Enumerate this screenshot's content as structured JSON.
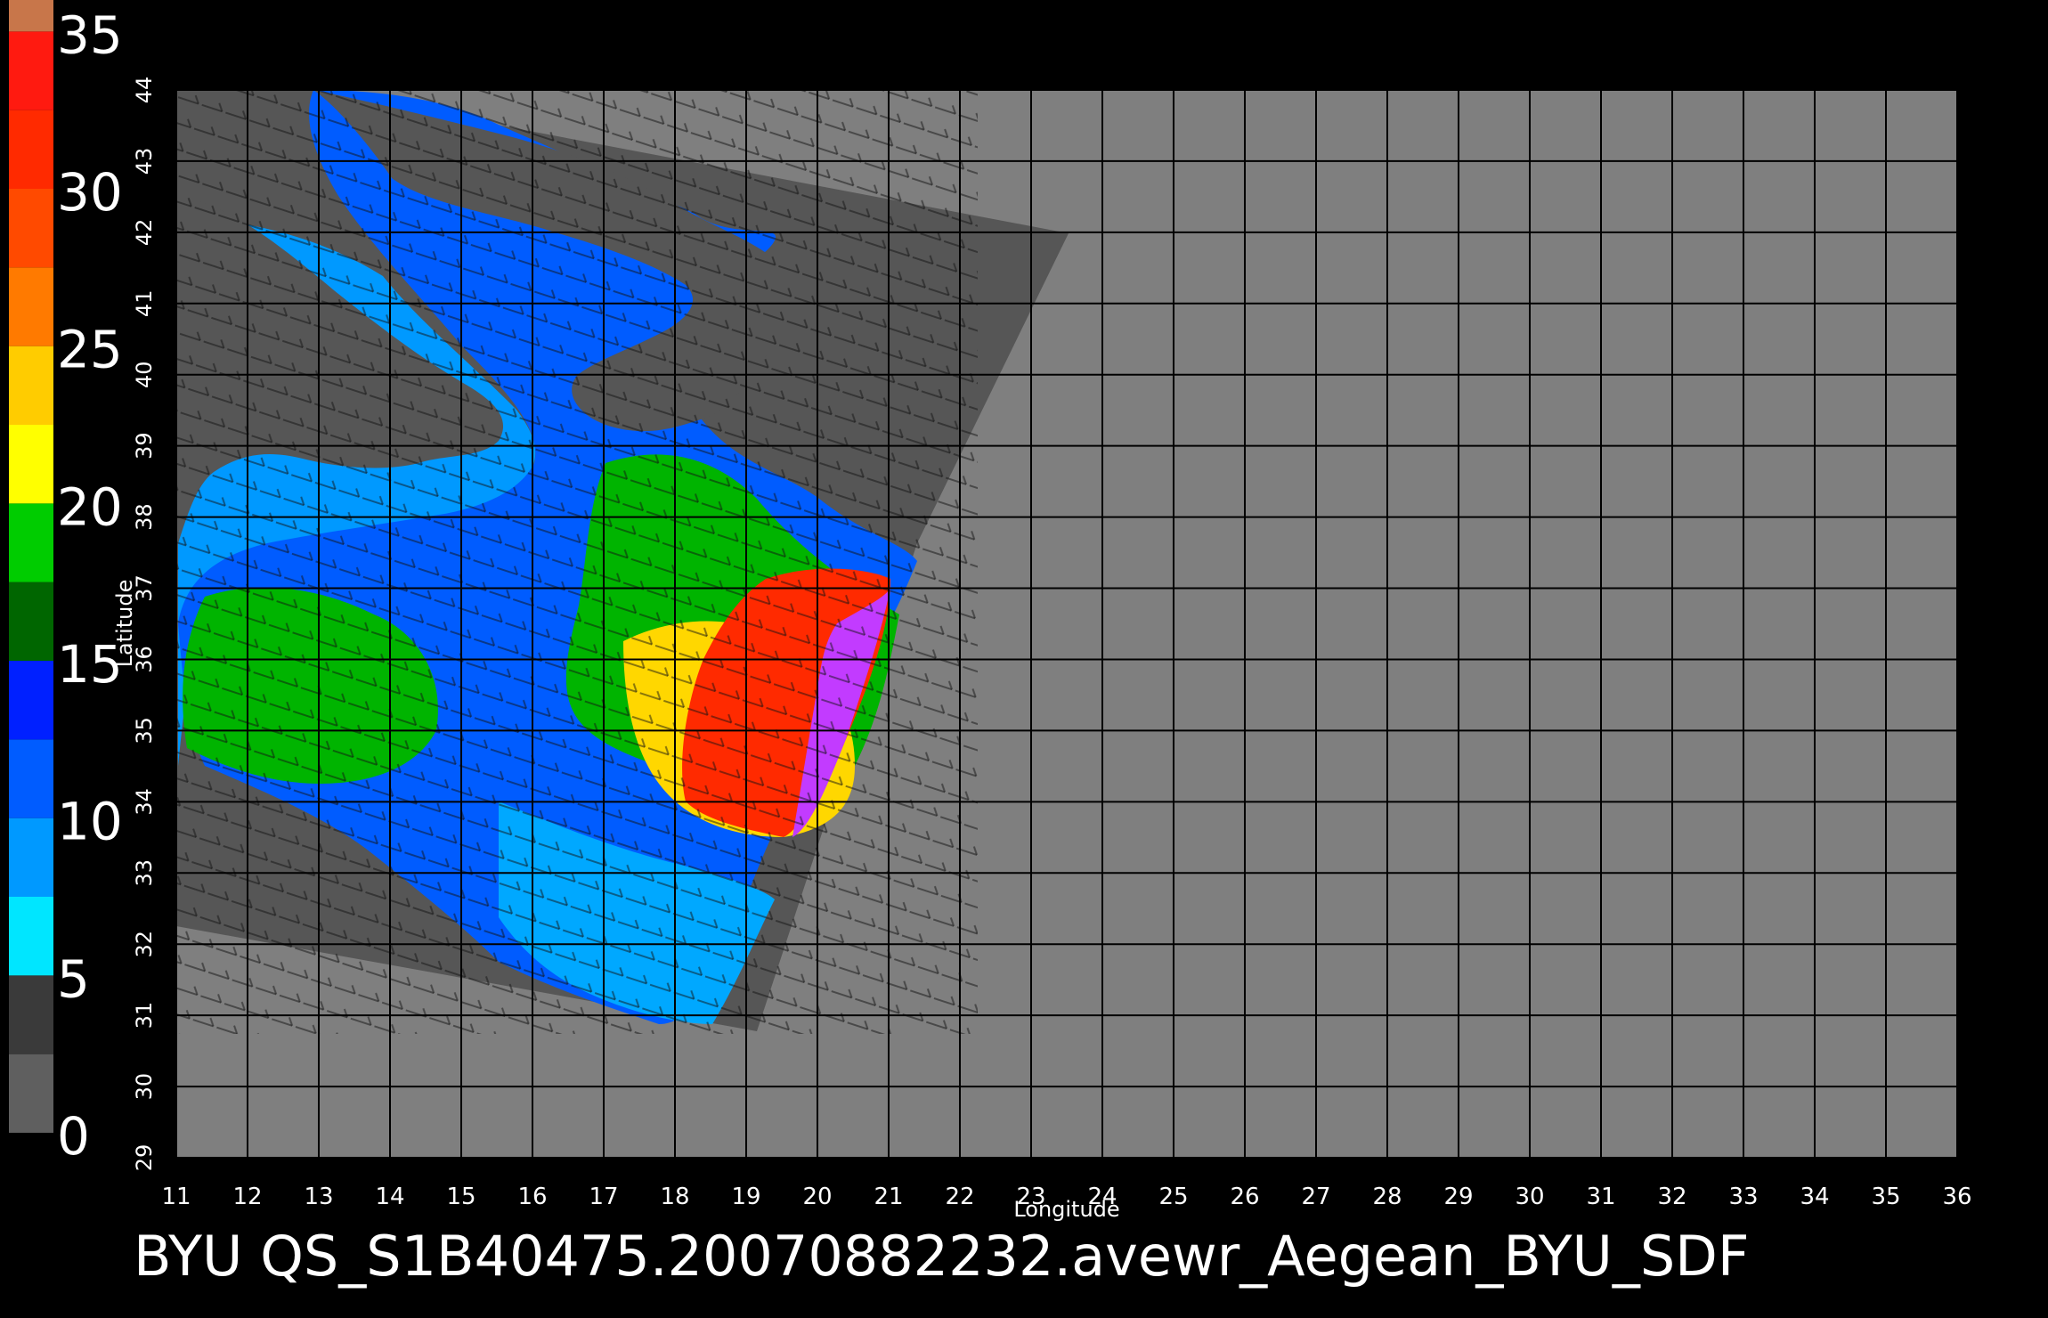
{
  "colorbar": {
    "labels": [
      "35",
      "30",
      "25",
      "20",
      "15",
      "10",
      "5",
      "0"
    ],
    "segments": [
      {
        "from": 0,
        "to": 2.5,
        "color": "#5f5f5f"
      },
      {
        "from": 2.5,
        "to": 5,
        "color": "#3a3a3a"
      },
      {
        "from": 5,
        "to": 7.5,
        "color": "#00e6ff"
      },
      {
        "from": 7.5,
        "to": 10,
        "color": "#0099ff"
      },
      {
        "from": 10,
        "to": 12.5,
        "color": "#005cff"
      },
      {
        "from": 12.5,
        "to": 15,
        "color": "#0020ff"
      },
      {
        "from": 15,
        "to": 17.5,
        "color": "#006600"
      },
      {
        "from": 17.5,
        "to": 20,
        "color": "#00cc00"
      },
      {
        "from": 20,
        "to": 22.5,
        "color": "#ffff00"
      },
      {
        "from": 22.5,
        "to": 25,
        "color": "#ffcc00"
      },
      {
        "from": 25,
        "to": 27.5,
        "color": "#ff7a00"
      },
      {
        "from": 27.5,
        "to": 30,
        "color": "#ff4a00"
      },
      {
        "from": 30,
        "to": 32.5,
        "color": "#ff2a00"
      },
      {
        "from": 32.5,
        "to": 35,
        "color": "#ff1a10"
      },
      {
        "from": 35,
        "to": 36,
        "color": "#c8764a"
      }
    ]
  },
  "map": {
    "lon_range": [
      11,
      36
    ],
    "lat_range": [
      29,
      44
    ],
    "lon_ticks": [
      "11",
      "12",
      "13",
      "14",
      "15",
      "16",
      "17",
      "18",
      "19",
      "20",
      "21",
      "22",
      "23",
      "24",
      "25",
      "26",
      "27",
      "28",
      "29",
      "30",
      "31",
      "32",
      "33",
      "34",
      "35",
      "36"
    ],
    "lat_ticks": [
      "29",
      "30",
      "31",
      "32",
      "33",
      "34",
      "35",
      "36",
      "37",
      "38",
      "39",
      "40",
      "41",
      "42",
      "43",
      "44"
    ],
    "xlabel": "Longitude",
    "ylabel": "Latitude",
    "background_color": "#7f7f7f",
    "swath_color": "#565656"
  },
  "caption": "BYU QS_S1B40475.20070882232.avewr_Aegean_BYU_SDF",
  "colors": {
    "land": "#565656",
    "calm_wind": "#00a8ff",
    "moderate_wind": "#0038ff",
    "fresh_wind": "#00b400",
    "strong_wind": "#ffd700",
    "gale_wind": "#ff2a00",
    "storm_wind": "#c23bff"
  }
}
